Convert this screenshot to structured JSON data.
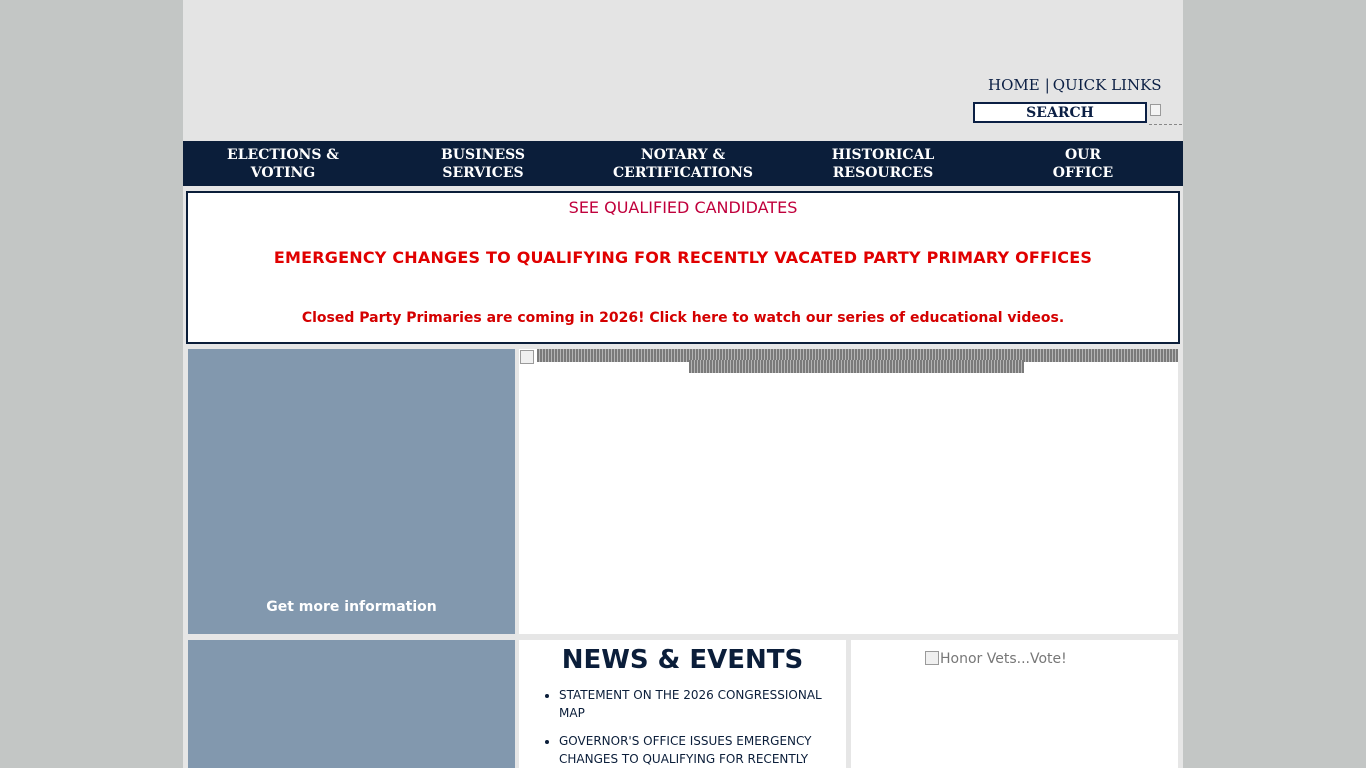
{
  "header": {
    "home_label": "HOME",
    "separator": "|",
    "quick_links_label": "QUICK LINKS",
    "search_label": "SEARCH"
  },
  "nav": {
    "items": [
      {
        "line1": "ELECTIONS &",
        "line2": "VOTING"
      },
      {
        "line1": "BUSINESS",
        "line2": "SERVICES"
      },
      {
        "line1": "NOTARY &",
        "line2": "CERTIFICATIONS"
      },
      {
        "line1": "HISTORICAL",
        "line2": "RESOURCES"
      },
      {
        "line1": "OUR",
        "line2": "OFFICE"
      }
    ]
  },
  "alert": {
    "candidates_link": "SEE QUALIFIED CANDIDATES",
    "emergency_link": "EMERGENCY CHANGES TO QUALIFYING FOR RECENTLY VACATED PARTY PRIMARY OFFICES",
    "primaries_link": "Closed Party Primaries are coming in 2026! Click here to watch our series of educational videos."
  },
  "info_panel": {
    "link_label": "Get more information"
  },
  "news": {
    "title": "NEWS & EVENTS",
    "items": [
      "STATEMENT ON THE 2026 CONGRESSIONAL MAP",
      "GOVERNOR'S OFFICE ISSUES EMERGENCY CHANGES TO QUALIFYING FOR RECENTLY VACATED PARTY PRIMARY OFFICES"
    ]
  },
  "vote_panel": {
    "image_alt": "Honor Vets...Vote!"
  },
  "colors": {
    "navy": "#0b1e3a",
    "panel_blue": "#8298ae",
    "alert_red": "#e00000",
    "candidates_crimson": "#c0003c",
    "page_gray": "#e6e6e6",
    "outer_gray": "#c3c6c5"
  },
  "icons": {
    "search_go": "broken-image-icon",
    "slideshow": "broken-image-icon",
    "vote": "broken-image-icon"
  }
}
